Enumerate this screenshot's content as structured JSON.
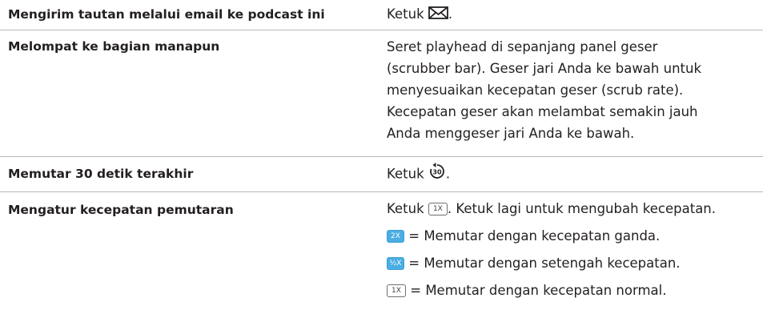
{
  "rows": [
    {
      "action": "Mengirim tautan melalui email ke podcast ini",
      "desc_before": "Ketuk ",
      "desc_after": ".",
      "icon": "email-icon"
    },
    {
      "action": "Melompat ke bagian manapun",
      "desc_lines": [
        "Seret playhead di sepanjang panel geser",
        "(scrubber bar). Geser jari Anda ke bawah untuk",
        "menyesuaikan kecepatan geser (scrub rate).",
        "Kecepatan geser akan melambat semakin jauh",
        "Anda menggeser jari Anda ke bawah."
      ]
    },
    {
      "action": "Memutar 30 detik terakhir",
      "desc_before": "Ketuk ",
      "desc_after": ".",
      "icon": "replay-30-icon",
      "icon_text": "30"
    },
    {
      "action": "Mengatur kecepatan pemutaran",
      "first_before": "Ketuk ",
      "first_badge": "1X",
      "first_after": ". Ketuk lagi untuk mengubah kecepatan.",
      "speeds": [
        {
          "badge": "2X",
          "text": " = Memutar dengan kecepatan ganda."
        },
        {
          "badge": "½X",
          "text": " = Memutar dengan setengah kecepatan."
        },
        {
          "badge": "1X",
          "text": " = Memutar dengan kecepatan normal."
        }
      ]
    }
  ],
  "colors": {
    "text": "#231f20",
    "rule": "#b7b7b7",
    "badge_blue": "#4aaee3"
  }
}
